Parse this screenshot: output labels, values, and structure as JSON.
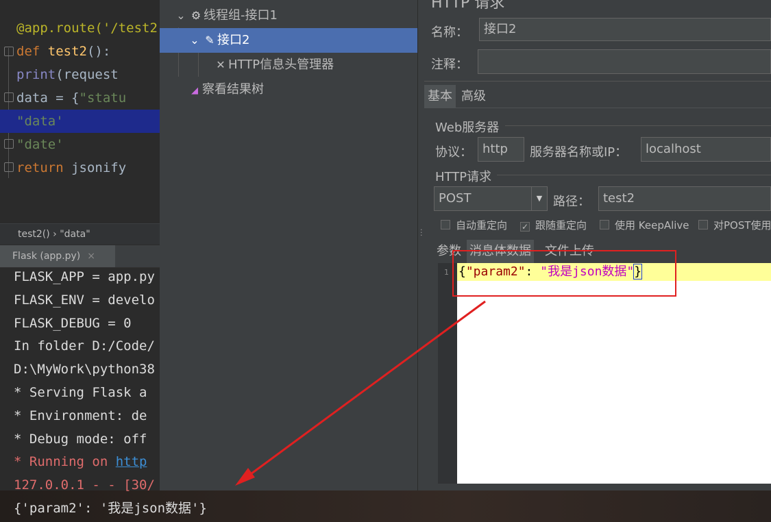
{
  "ide": {
    "editor_lines": [
      {
        "parts": [
          {
            "t": "@app.route('/test2",
            "c": "dec"
          }
        ]
      },
      {
        "parts": [
          {
            "t": "def ",
            "c": "kw"
          },
          {
            "t": "test2",
            "c": "fn"
          },
          {
            "t": "():",
            "c": ""
          }
        ]
      },
      {
        "parts": [
          {
            "t": "    ",
            "c": ""
          },
          {
            "t": "print",
            "c": "bi"
          },
          {
            "t": "(request",
            "c": ""
          }
        ]
      },
      {
        "parts": [
          {
            "t": "    data = {",
            "c": ""
          },
          {
            "t": "\"statu",
            "c": "str"
          }
        ]
      },
      {
        "parts": [
          {
            "t": "            ",
            "c": ""
          },
          {
            "t": "\"data'",
            "c": "str"
          }
        ]
      },
      {
        "parts": [
          {
            "t": "            ",
            "c": ""
          },
          {
            "t": "\"date'",
            "c": "str"
          }
        ]
      },
      {
        "parts": [
          {
            "t": "    ",
            "c": ""
          },
          {
            "t": "return ",
            "c": "kw"
          },
          {
            "t": "jsonify",
            "c": ""
          }
        ]
      }
    ],
    "breadcrumb": "test2()  ›  \"data\"",
    "run_tab_label": "Flask (app.py)",
    "run_tab_close": "×",
    "console_lines": [
      {
        "text": "FLASK_APP = app.py",
        "style": ""
      },
      {
        "text": "FLASK_ENV = develo",
        "style": ""
      },
      {
        "text": "FLASK_DEBUG = 0",
        "style": ""
      },
      {
        "text": "In folder D:/Code/",
        "style": ""
      },
      {
        "text": "D:\\MyWork\\python38",
        "style": ""
      },
      {
        "text": " * Serving Flask a",
        "style": ""
      },
      {
        "text": " * Environment: de",
        "style": ""
      },
      {
        "text": " * Debug mode: off",
        "style": ""
      },
      {
        "text": " * Running on ",
        "style": "red",
        "link": "http"
      },
      {
        "text": "127.0.0.1 - - [30/",
        "style": "red"
      },
      {
        "text": "{'param2': '我是json数据'}",
        "style": ""
      }
    ]
  },
  "jmeter": {
    "tree": {
      "thread_group": "线程组-接口1",
      "sampler": "接口2",
      "header_manager": "HTTP信息头管理器",
      "result_tree": "察看结果树"
    },
    "form": {
      "panel_title": "HTTP 请求",
      "name_label": "名称：",
      "name_value": "接口2",
      "comment_label": "注释：",
      "comment_value": "",
      "tabs": [
        "基本",
        "高级"
      ],
      "web_server_title": "Web服务器",
      "protocol_label": "协议：",
      "protocol_value": "http",
      "server_label": "服务器名称或IP：",
      "server_value": "localhost",
      "http_request_title": "HTTP请求",
      "method_value": "POST",
      "path_label": "路径：",
      "path_value": "test2",
      "checkboxes": [
        {
          "label": "自动重定向",
          "checked": false
        },
        {
          "label": "跟随重定向",
          "checked": true
        },
        {
          "label": "使用 KeepAlive",
          "checked": false
        },
        {
          "label": "对POST使用",
          "checked": false
        }
      ],
      "body_tabs": [
        "参数",
        "消息体数据",
        "文件上传"
      ],
      "body_line_number": "1",
      "body": {
        "open": "{",
        "key": "\"param2\"",
        "colon": ": ",
        "value": "\"我是json数据\"",
        "close": "}"
      }
    }
  },
  "colors": {
    "annotation": "#e02020",
    "selection": "#4b6eaf"
  }
}
